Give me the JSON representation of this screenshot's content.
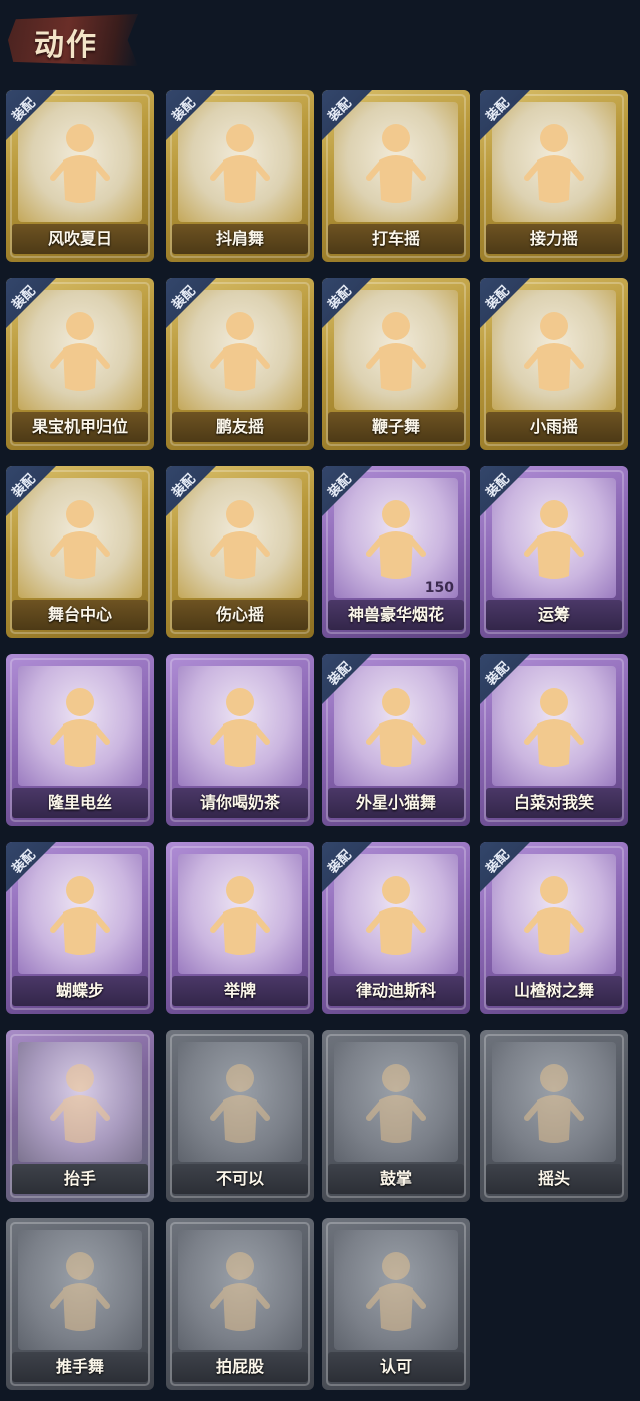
{
  "header": {
    "title": "动作"
  },
  "badge_label": "装配",
  "cards": [
    {
      "label": "风吹夏日",
      "tier": "gold",
      "equipped": true
    },
    {
      "label": "抖肩舞",
      "tier": "gold",
      "equipped": true
    },
    {
      "label": "打车摇",
      "tier": "gold",
      "equipped": true
    },
    {
      "label": "接力摇",
      "tier": "gold",
      "equipped": true
    },
    {
      "label": "果宝机甲归位",
      "tier": "gold",
      "equipped": true
    },
    {
      "label": "鹏友摇",
      "tier": "gold",
      "equipped": true
    },
    {
      "label": "鞭子舞",
      "tier": "gold",
      "equipped": true
    },
    {
      "label": "小雨摇",
      "tier": "gold",
      "equipped": true
    },
    {
      "label": "舞台中心",
      "tier": "gold",
      "equipped": true
    },
    {
      "label": "伤心摇",
      "tier": "gold",
      "equipped": true
    },
    {
      "label": "神兽豪华烟花",
      "tier": "purple",
      "equipped": true,
      "count": "150"
    },
    {
      "label": "运筹",
      "tier": "purple",
      "equipped": true
    },
    {
      "label": "隆里电丝",
      "tier": "purple",
      "equipped": false
    },
    {
      "label": "请你喝奶茶",
      "tier": "purple",
      "equipped": false
    },
    {
      "label": "外星小猫舞",
      "tier": "purple",
      "equipped": true
    },
    {
      "label": "白菜对我笑",
      "tier": "purple",
      "equipped": true
    },
    {
      "label": "蝴蝶步",
      "tier": "purple",
      "equipped": true
    },
    {
      "label": "举牌",
      "tier": "purple",
      "equipped": false
    },
    {
      "label": "律动迪斯科",
      "tier": "purple",
      "equipped": true
    },
    {
      "label": "山楂树之舞",
      "tier": "purple",
      "equipped": true
    },
    {
      "label": "抬手",
      "tier": "fade",
      "equipped": false
    },
    {
      "label": "不可以",
      "tier": "gray",
      "equipped": false
    },
    {
      "label": "鼓掌",
      "tier": "gray",
      "equipped": false
    },
    {
      "label": "摇头",
      "tier": "gray",
      "equipped": false
    },
    {
      "label": "推手舞",
      "tier": "gray",
      "equipped": false
    },
    {
      "label": "拍屁股",
      "tier": "gray",
      "equipped": false
    },
    {
      "label": "认可",
      "tier": "gray",
      "equipped": false
    }
  ],
  "colors": {
    "background": "#0f1724",
    "gold": "#c4a84a",
    "purple": "#9b7cc0",
    "gray": "#6f747d",
    "badge": "#2e4066"
  }
}
